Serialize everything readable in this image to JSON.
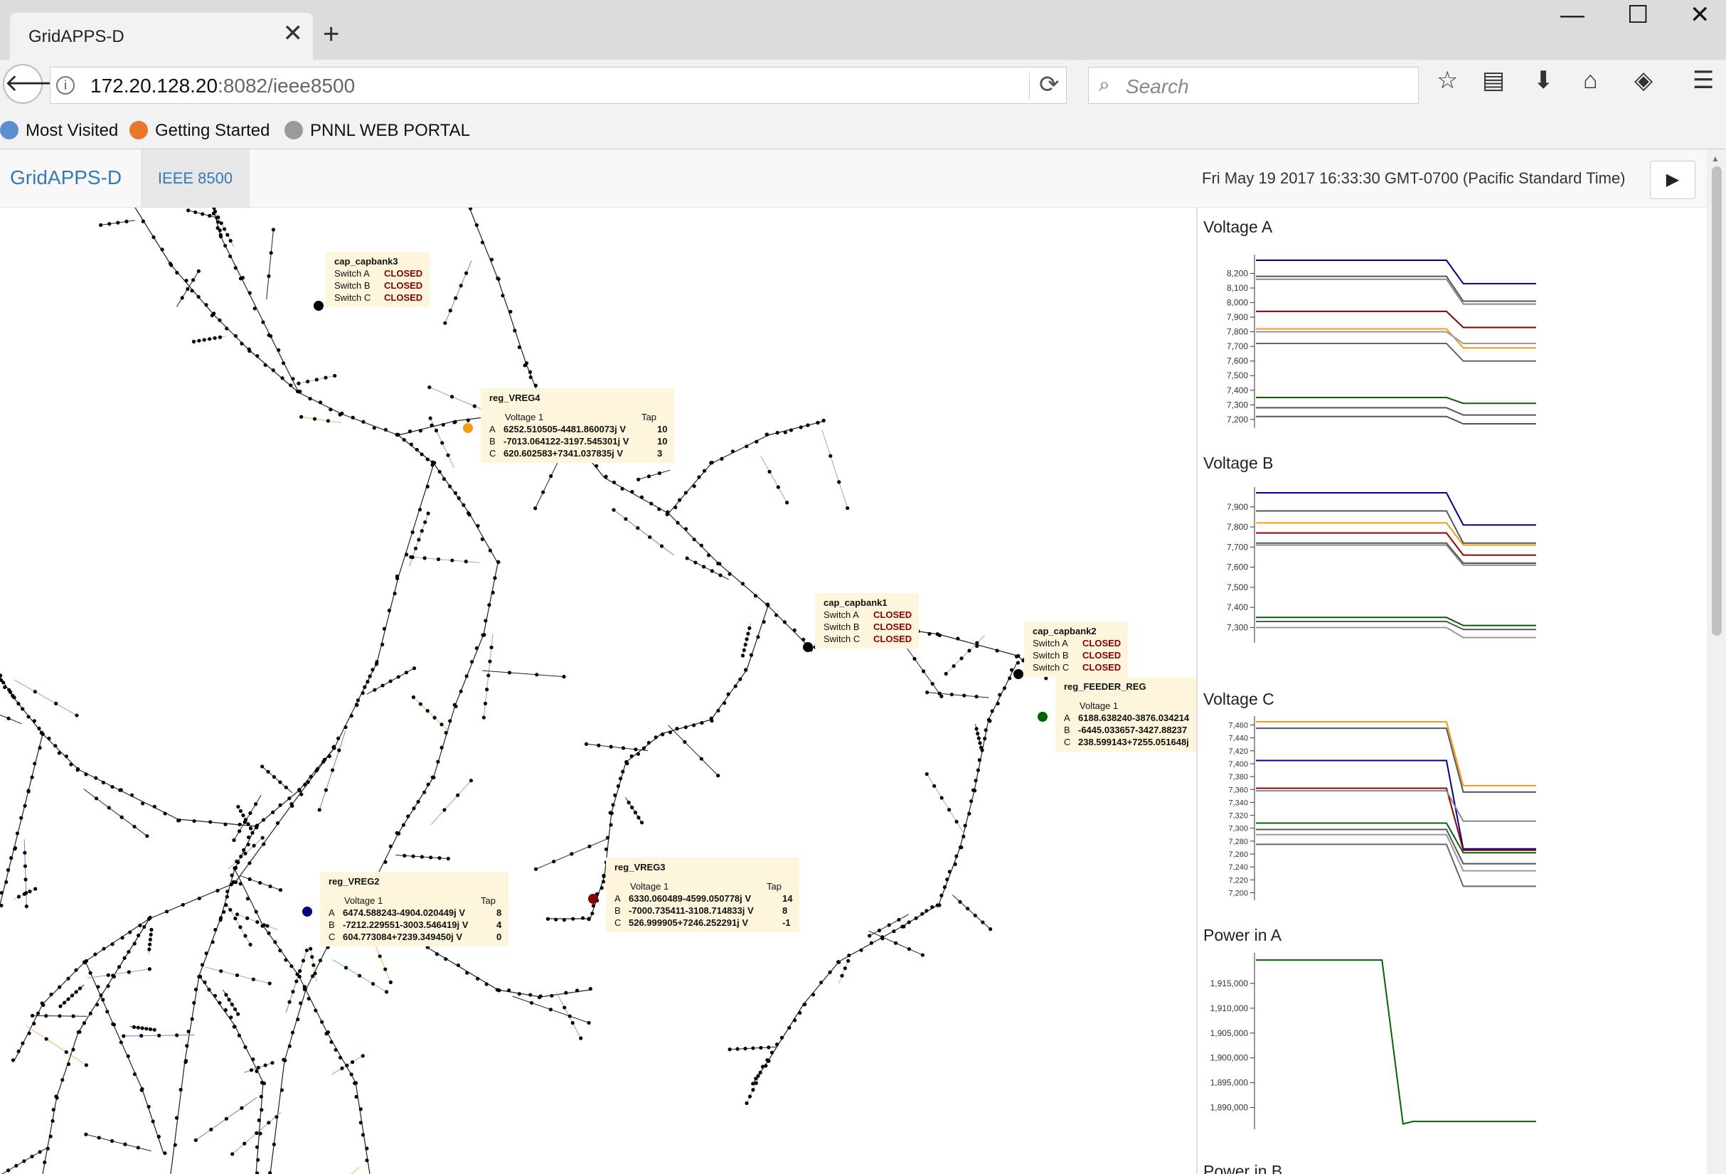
{
  "browser": {
    "tab_title": "GridAPPS-D",
    "close_tab": "✕",
    "new_tab": "+",
    "window_buttons": [
      "—",
      "☐",
      "✕"
    ],
    "back_glyph": "🡐",
    "info_glyph": "i",
    "url_host": "172.20.128.20",
    "url_rest": ":8082/ieee8500",
    "reload_glyph": "⟳",
    "search_glyph": "⌕",
    "search_placeholder": "Search",
    "toolbar_icons": [
      {
        "name": "bookmark-star-icon",
        "glyph": "☆"
      },
      {
        "name": "library-icon",
        "glyph": "▤"
      },
      {
        "name": "downloads-icon",
        "glyph": "⬇"
      },
      {
        "name": "home-icon",
        "glyph": "⌂"
      },
      {
        "name": "pocket-icon",
        "glyph": "◈"
      },
      {
        "name": "menu-icon",
        "glyph": "☰"
      }
    ],
    "bookmarks": [
      {
        "label": "Most Visited",
        "color": "#5b8fd0"
      },
      {
        "label": "Getting Started",
        "color": "#e8762b"
      },
      {
        "label": "PNNL WEB PORTAL",
        "color": "#9a9a9a"
      }
    ]
  },
  "app": {
    "brand": "GridAPPS-D",
    "tab": "IEEE 8500",
    "timestamp": "Fri May 19 2017 16:33:30 GMT-0700 (Pacific Standard Time)",
    "play_glyph": "▶"
  },
  "map": {
    "capacitors": [
      {
        "title": "cap_capbank3",
        "switches": [
          [
            "Switch A",
            "CLOSED"
          ],
          [
            "Switch B",
            "CLOSED"
          ],
          [
            "Switch C",
            "CLOSED"
          ]
        ]
      },
      {
        "title": "cap_capbank1",
        "switches": [
          [
            "Switch A",
            "CLOSED"
          ],
          [
            "Switch B",
            "CLOSED"
          ],
          [
            "Switch C",
            "CLOSED"
          ]
        ]
      },
      {
        "title": "cap_capbank2",
        "switches": [
          [
            "Switch A",
            "CLOSED"
          ],
          [
            "Switch B",
            "CLOSED"
          ],
          [
            "Switch C",
            "CLOSED"
          ]
        ]
      }
    ],
    "regulators": [
      {
        "title": "reg_VREG4",
        "voltage_header": "Voltage 1",
        "tap_header": "Tap",
        "rows": [
          [
            "A",
            "6252.510505-4481.860073j V",
            "10"
          ],
          [
            "B",
            "-7013.064122-3197.545301j V",
            "10"
          ],
          [
            "C",
            "620.602583+7341.037835j V",
            "3"
          ]
        ]
      },
      {
        "title": "reg_VREG2",
        "voltage_header": "Voltage 1",
        "tap_header": "Tap",
        "rows": [
          [
            "A",
            "6474.588243-4904.020449j V",
            "8"
          ],
          [
            "B",
            "-7212.229551-3003.546419j V",
            "4"
          ],
          [
            "C",
            "604.773084+7239.349450j V",
            "0"
          ]
        ]
      },
      {
        "title": "reg_VREG3",
        "voltage_header": "Voltage 1",
        "tap_header": "Tap",
        "rows": [
          [
            "A",
            "6330.060489-4599.050778j V",
            "14"
          ],
          [
            "B",
            "-7000.735411-3108.714833j V",
            "8"
          ],
          [
            "C",
            "526.999905+7246.252291j V",
            "-1"
          ]
        ]
      },
      {
        "title": "reg_FEEDER_REG",
        "voltage_header": "Voltage 1",
        "tap_header": "",
        "rows": [
          [
            "A",
            "6188.638240-3876.034214",
            ""
          ],
          [
            "B",
            "-6445.033657-3427.88237",
            ""
          ],
          [
            "C",
            "238.599143+7255.051648j",
            ""
          ]
        ]
      }
    ],
    "regulator_colors": [
      "#f39c12",
      "#000080",
      "#8b0000",
      "#006400"
    ]
  },
  "chart_data": [
    {
      "type": "line",
      "title": "Voltage A",
      "ylim": [
        7170,
        8290
      ],
      "yticks": [
        8200,
        8100,
        8000,
        7900,
        7800,
        7700,
        7600,
        7500,
        7400,
        7300,
        7200
      ],
      "ytick_labels": [
        "8,200",
        "8,100",
        "8,000",
        "7,900",
        "7,800",
        "7,700",
        "7,600",
        "7,500",
        "7,400",
        "7,300",
        "7,200"
      ],
      "x": [
        0,
        1,
        2,
        3
      ],
      "series": [
        {
          "color": "#00008b",
          "values": [
            8290,
            8290,
            8130,
            8130
          ]
        },
        {
          "color": "#555555",
          "values": [
            8180,
            8180,
            8010,
            8010
          ]
        },
        {
          "color": "#888888",
          "values": [
            8160,
            8160,
            7990,
            7990
          ]
        },
        {
          "color": "#8b0000",
          "values": [
            7940,
            7940,
            7830,
            7830
          ]
        },
        {
          "color": "#f39c12",
          "values": [
            7820,
            7820,
            7690,
            7690
          ]
        },
        {
          "color": "#999999",
          "values": [
            7800,
            7800,
            7720,
            7720
          ]
        },
        {
          "color": "#666666",
          "values": [
            7720,
            7720,
            7600,
            7600
          ]
        },
        {
          "color": "#006400",
          "values": [
            7350,
            7350,
            7310,
            7310
          ]
        },
        {
          "color": "#555555",
          "values": [
            7280,
            7280,
            7230,
            7230
          ]
        },
        {
          "color": "#555555",
          "values": [
            7220,
            7220,
            7170,
            7170
          ]
        }
      ]
    },
    {
      "type": "line",
      "title": "Voltage B",
      "ylim": [
        7245,
        7970
      ],
      "yticks": [
        7900,
        7800,
        7700,
        7600,
        7500,
        7400,
        7300
      ],
      "ytick_labels": [
        "7,900",
        "7,800",
        "7,700",
        "7,600",
        "7,500",
        "7,400",
        "7,300"
      ],
      "x": [
        0,
        1,
        2,
        3
      ],
      "series": [
        {
          "color": "#00008b",
          "values": [
            7970,
            7970,
            7810,
            7810
          ]
        },
        {
          "color": "#555555",
          "values": [
            7880,
            7880,
            7720,
            7720
          ]
        },
        {
          "color": "#f39c12",
          "values": [
            7820,
            7820,
            7710,
            7710
          ]
        },
        {
          "color": "#8b0000",
          "values": [
            7770,
            7770,
            7660,
            7660
          ]
        },
        {
          "color": "#555555",
          "values": [
            7720,
            7720,
            7620,
            7620
          ]
        },
        {
          "color": "#888888",
          "values": [
            7710,
            7710,
            7610,
            7610
          ]
        },
        {
          "color": "#006400",
          "values": [
            7350,
            7350,
            7310,
            7310
          ]
        },
        {
          "color": "#555555",
          "values": [
            7330,
            7330,
            7290,
            7290
          ]
        },
        {
          "color": "#999999",
          "values": [
            7300,
            7300,
            7250,
            7250
          ]
        }
      ]
    },
    {
      "type": "line",
      "title": "Voltage C",
      "ylim": [
        7195,
        7465
      ],
      "yticks": [
        7460,
        7440,
        7420,
        7400,
        7380,
        7360,
        7340,
        7320,
        7300,
        7280,
        7260,
        7240,
        7220,
        7200
      ],
      "ytick_labels": [
        "7,460",
        "7,440",
        "7,420",
        "7,400",
        "7,380",
        "7,360",
        "7,340",
        "7,320",
        "7,300",
        "7,280",
        "7,260",
        "7,240",
        "7,220",
        "7,200"
      ],
      "x": [
        0,
        1,
        2,
        3
      ],
      "series": [
        {
          "color": "#f39c12",
          "values": [
            7465,
            7465,
            7366,
            7366
          ]
        },
        {
          "color": "#555555",
          "values": [
            7455,
            7455,
            7356,
            7356
          ]
        },
        {
          "color": "#00008b",
          "values": [
            7405,
            7405,
            7268,
            7268
          ]
        },
        {
          "color": "#8b0000",
          "values": [
            7362,
            7362,
            7266,
            7266
          ]
        },
        {
          "color": "#888888",
          "values": [
            7358,
            7358,
            7311,
            7311
          ]
        },
        {
          "color": "#006400",
          "values": [
            7308,
            7308,
            7262,
            7262
          ]
        },
        {
          "color": "#555555",
          "values": [
            7298,
            7298,
            7245,
            7245
          ]
        },
        {
          "color": "#999999",
          "values": [
            7290,
            7290,
            7234,
            7234
          ]
        },
        {
          "color": "#666666",
          "values": [
            7275,
            7275,
            7210,
            7210
          ]
        }
      ]
    },
    {
      "type": "line",
      "title": "Power in A",
      "ylim": [
        1886500,
        1920000
      ],
      "yticks": [
        1915000,
        1910000,
        1905000,
        1900000,
        1895000,
        1890000
      ],
      "ytick_labels": [
        "1,915,000",
        "1,910,000",
        "1,905,000",
        "1,900,000",
        "1,895,000",
        "1,890,000"
      ],
      "x": [
        0,
        1,
        2,
        3,
        4
      ],
      "series": [
        {
          "color": "#006400",
          "values": [
            1919700,
            1919700,
            1886700,
            1887200,
            1887200
          ]
        }
      ]
    },
    {
      "type": "line",
      "title": "Power in B"
    }
  ]
}
